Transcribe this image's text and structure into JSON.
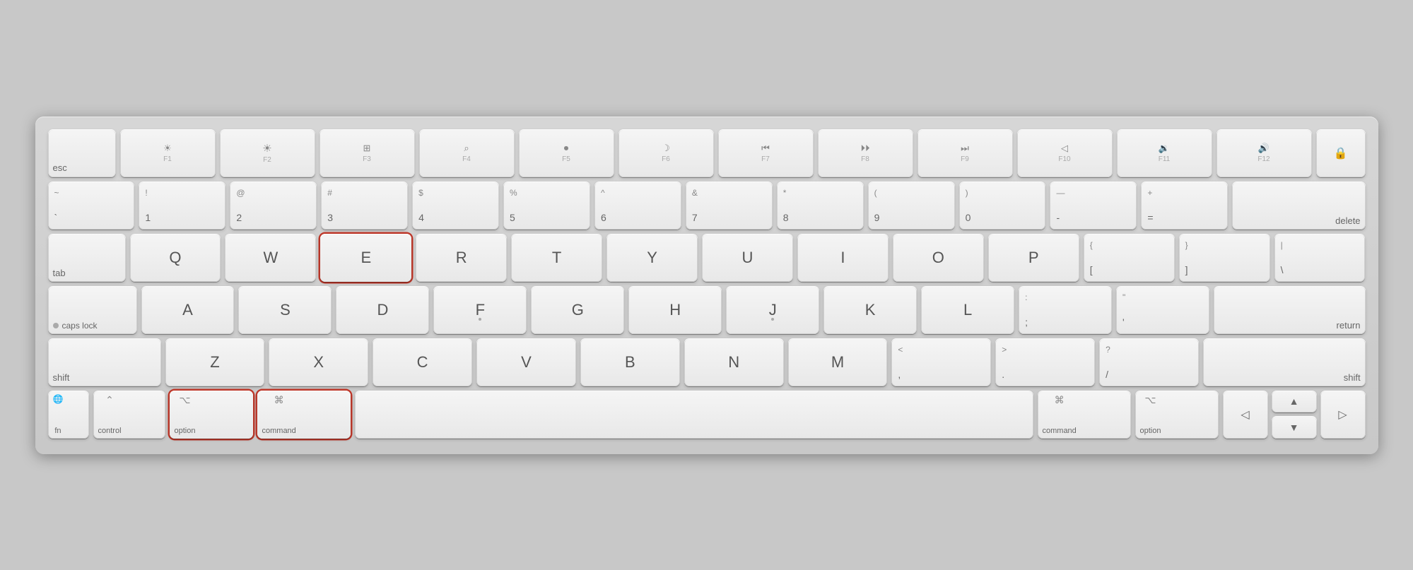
{
  "keyboard": {
    "rows": {
      "row1": {
        "keys": [
          {
            "id": "esc",
            "label": "esc",
            "type": "esc"
          },
          {
            "id": "f1",
            "symbol": "☀",
            "label": "F1",
            "type": "fkey"
          },
          {
            "id": "f2",
            "symbol": "☀",
            "label": "F2",
            "type": "fkey"
          },
          {
            "id": "f3",
            "symbol": "⊞",
            "label": "F3",
            "type": "fkey"
          },
          {
            "id": "f4",
            "symbol": "⌕",
            "label": "F4",
            "type": "fkey"
          },
          {
            "id": "f5",
            "symbol": "🎤",
            "label": "F5",
            "type": "fkey"
          },
          {
            "id": "f6",
            "symbol": "🌙",
            "label": "F6",
            "type": "fkey"
          },
          {
            "id": "f7",
            "symbol": "⏮",
            "label": "F7",
            "type": "fkey"
          },
          {
            "id": "f8",
            "symbol": "⏯",
            "label": "F8",
            "type": "fkey"
          },
          {
            "id": "f9",
            "symbol": "⏭",
            "label": "F9",
            "type": "fkey"
          },
          {
            "id": "f10",
            "symbol": "🔇",
            "label": "F10",
            "type": "fkey"
          },
          {
            "id": "f11",
            "symbol": "🔉",
            "label": "F11",
            "type": "fkey"
          },
          {
            "id": "f12",
            "symbol": "🔊",
            "label": "F12",
            "type": "fkey"
          },
          {
            "id": "lock",
            "symbol": "🔒",
            "label": "",
            "type": "lock"
          }
        ]
      },
      "row2": {
        "keys": [
          {
            "id": "tilde",
            "top": "~",
            "bottom": "`"
          },
          {
            "id": "1",
            "top": "!",
            "bottom": "1"
          },
          {
            "id": "2",
            "top": "@",
            "bottom": "2"
          },
          {
            "id": "3",
            "top": "#",
            "bottom": "3"
          },
          {
            "id": "4",
            "top": "$",
            "bottom": "4"
          },
          {
            "id": "5",
            "top": "%",
            "bottom": "5"
          },
          {
            "id": "6",
            "top": "^",
            "bottom": "6"
          },
          {
            "id": "7",
            "top": "&",
            "bottom": "7"
          },
          {
            "id": "8",
            "top": "*",
            "bottom": "8"
          },
          {
            "id": "9",
            "top": "(",
            "bottom": "9"
          },
          {
            "id": "0",
            "top": ")",
            "bottom": "0"
          },
          {
            "id": "minus",
            "top": "—",
            "bottom": "-"
          },
          {
            "id": "equals",
            "top": "+",
            "bottom": "="
          },
          {
            "id": "delete",
            "label": "delete"
          }
        ]
      },
      "row3": {
        "keys": [
          {
            "id": "tab",
            "label": "tab"
          },
          {
            "id": "q",
            "letter": "Q"
          },
          {
            "id": "w",
            "letter": "W"
          },
          {
            "id": "e",
            "letter": "E",
            "highlighted": true
          },
          {
            "id": "r",
            "letter": "R"
          },
          {
            "id": "t",
            "letter": "T"
          },
          {
            "id": "y",
            "letter": "Y"
          },
          {
            "id": "u",
            "letter": "U"
          },
          {
            "id": "i",
            "letter": "I"
          },
          {
            "id": "o",
            "letter": "O"
          },
          {
            "id": "p",
            "letter": "P"
          },
          {
            "id": "lbracket",
            "top": "{",
            "bottom": "["
          },
          {
            "id": "rbracket",
            "top": "}",
            "bottom": "]"
          },
          {
            "id": "backslash",
            "top": "|",
            "bottom": "\\"
          }
        ]
      },
      "row4": {
        "keys": [
          {
            "id": "caps",
            "label": "caps lock"
          },
          {
            "id": "a",
            "letter": "A"
          },
          {
            "id": "s",
            "letter": "S"
          },
          {
            "id": "d",
            "letter": "D"
          },
          {
            "id": "f",
            "letter": "F"
          },
          {
            "id": "g",
            "letter": "G"
          },
          {
            "id": "h",
            "letter": "H"
          },
          {
            "id": "j",
            "letter": "J"
          },
          {
            "id": "k",
            "letter": "K"
          },
          {
            "id": "l",
            "letter": "L"
          },
          {
            "id": "semicolon",
            "top": ":",
            "bottom": ";"
          },
          {
            "id": "quote",
            "top": "\"",
            "bottom": "'"
          },
          {
            "id": "return",
            "label": "return"
          }
        ]
      },
      "row5": {
        "keys": [
          {
            "id": "shift-l",
            "label": "shift"
          },
          {
            "id": "z",
            "letter": "Z"
          },
          {
            "id": "x",
            "letter": "X"
          },
          {
            "id": "c",
            "letter": "C"
          },
          {
            "id": "v",
            "letter": "V"
          },
          {
            "id": "b",
            "letter": "B"
          },
          {
            "id": "n",
            "letter": "N"
          },
          {
            "id": "m",
            "letter": "M"
          },
          {
            "id": "comma",
            "top": "<",
            "bottom": ","
          },
          {
            "id": "period",
            "top": ">",
            "bottom": "."
          },
          {
            "id": "slash",
            "top": "?",
            "bottom": "/"
          },
          {
            "id": "shift-r",
            "label": "shift"
          }
        ]
      },
      "row6": {
        "fn": "fn",
        "fn_symbol": "🌐",
        "control": "control",
        "control_symbol": "⌃",
        "option_l": "option",
        "option_l_symbol": "⌥",
        "command_l": "command",
        "command_l_symbol": "⌘",
        "space": "",
        "command_r": "command",
        "command_r_symbol": "⌘",
        "option_r": "option",
        "option_r_symbol": "⌥"
      }
    }
  }
}
